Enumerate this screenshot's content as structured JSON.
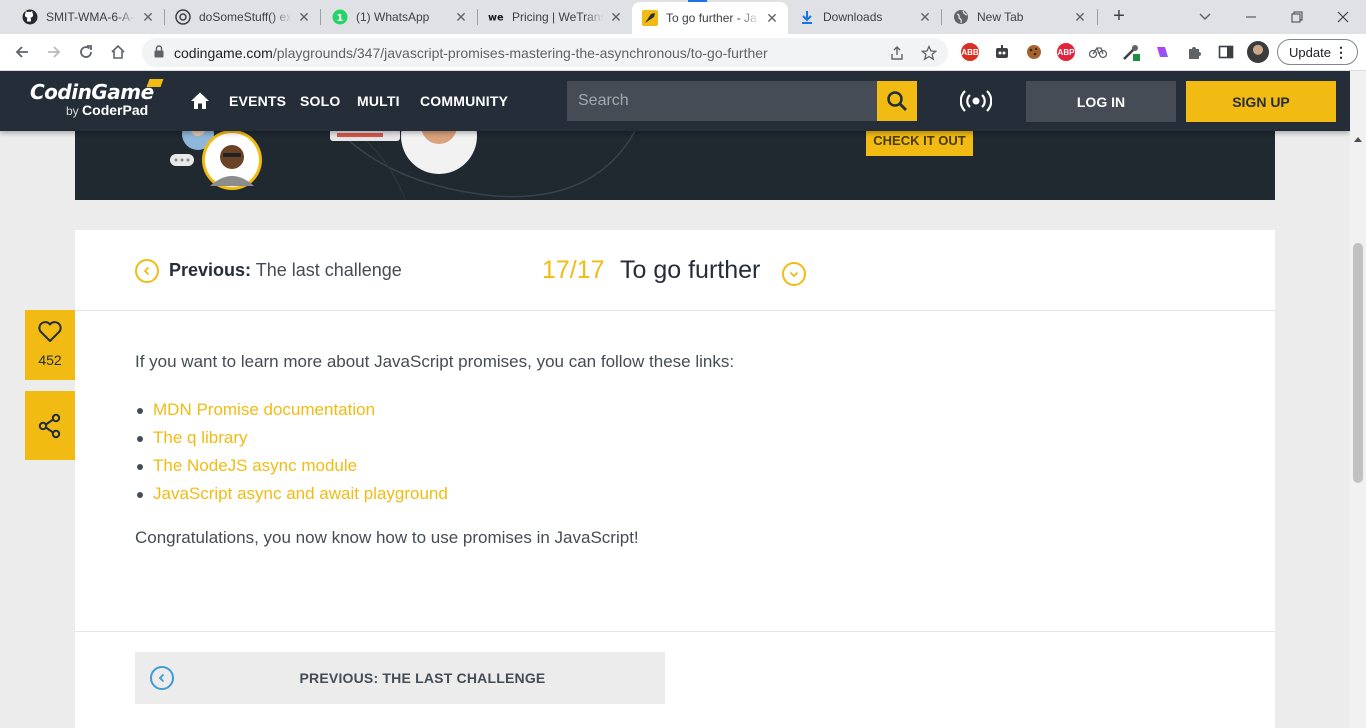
{
  "browser": {
    "tabs": [
      {
        "title": "SMIT-WMA-6-A-",
        "icon": "github-icon"
      },
      {
        "title": "doSomeStuff() ex",
        "icon": "openai-icon"
      },
      {
        "title": "(1) WhatsApp",
        "icon": "whatsapp-icon"
      },
      {
        "title": "Pricing | WeTrans",
        "icon": "wetransfer-icon"
      },
      {
        "title": "To go further - Ja",
        "icon": "codingame-icon",
        "active": true
      },
      {
        "title": "Downloads",
        "icon": "download-icon"
      },
      {
        "title": "New Tab",
        "icon": "globe-icon"
      }
    ],
    "url_host": "codingame.com",
    "url_path": "/playgrounds/347/javascript-promises-mastering-the-asynchronous/to-go-further",
    "update_label": "Update"
  },
  "site": {
    "logo_main": "CodinGame",
    "logo_by": "by",
    "logo_sub": "CoderPad",
    "nav": [
      "EVENTS",
      "SOLO",
      "MULTI",
      "COMMUNITY"
    ],
    "search_placeholder": "Search",
    "login_label": "LOG IN",
    "signup_label": "SIGN UP",
    "banner_cta": "CHECK IT OUT",
    "accent_color": "#f2bb13",
    "nav_bg": "#252e38"
  },
  "lesson": {
    "previous_prefix": "Previous:",
    "previous_title": "The last challenge",
    "step": "17/17",
    "title": "To go further",
    "intro": "If you want to learn more about JavaScript promises, you can follow these links:",
    "links": [
      "MDN Promise documentation",
      "The q library",
      "The NodeJS async module",
      "JavaScript async and await playground"
    ],
    "outro": "Congratulations, you now know how to use promises in JavaScript!",
    "bottom_previous": "PREVIOUS: THE LAST CHALLENGE",
    "likes": "452"
  }
}
